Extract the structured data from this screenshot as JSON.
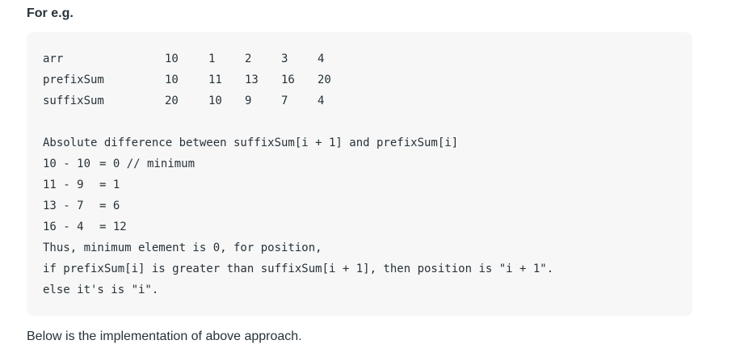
{
  "heading": "For e.g.",
  "table": {
    "rows": [
      {
        "label": "arr",
        "values": [
          "10",
          "1",
          "2",
          "3",
          "4"
        ]
      },
      {
        "label": "prefixSum",
        "values": [
          "10",
          "11",
          "13",
          "16",
          "20"
        ]
      },
      {
        "label": "suffixSum",
        "values": [
          "20",
          "10",
          "9",
          "7",
          "4"
        ]
      }
    ]
  },
  "explanation": {
    "title": "Absolute difference between suffixSum[i + 1] and prefixSum[i]",
    "calcs": [
      {
        "expr": "10 - 10",
        "result": "= 0 // minimum"
      },
      {
        "expr": "11 - 9",
        "result": "= 1"
      },
      {
        "expr": "13 - 7",
        "result": "= 6"
      },
      {
        "expr": "16 - 4",
        "result": "= 12"
      }
    ],
    "conclusion": [
      "Thus, minimum element is 0, for position,",
      "if prefixSum[i] is greater than suffixSum[i + 1], then position is \"i + 1\".",
      "else it's is \"i\"."
    ]
  },
  "footer": "Below is the implementation of above approach."
}
